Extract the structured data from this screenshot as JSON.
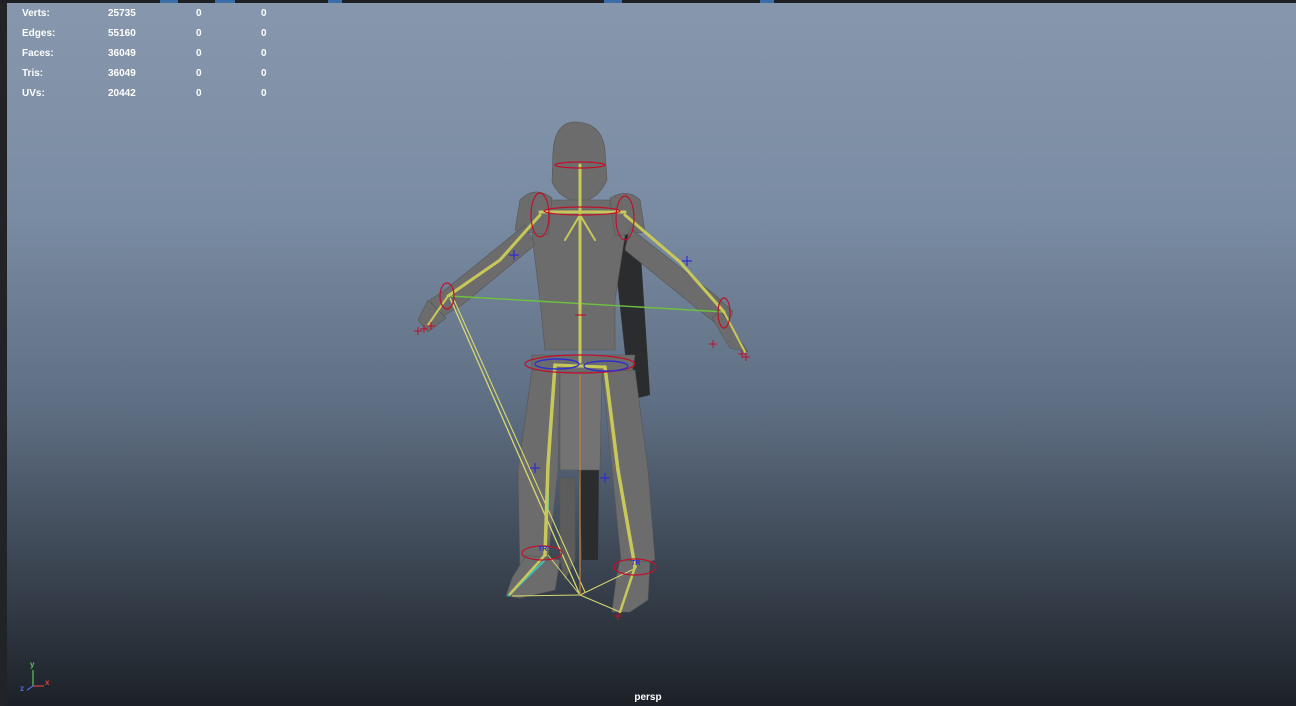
{
  "hud": {
    "rows": [
      {
        "label": "Verts:",
        "total": "25735",
        "selected": "0",
        "third": "0"
      },
      {
        "label": "Edges:",
        "total": "55160",
        "selected": "0",
        "third": "0"
      },
      {
        "label": "Faces:",
        "total": "36049",
        "selected": "0",
        "third": "0"
      },
      {
        "label": "Tris:",
        "total": "36049",
        "selected": "0",
        "third": "0"
      },
      {
        "label": "UVs:",
        "total": "20442",
        "selected": "0",
        "third": "0"
      }
    ]
  },
  "viewport": {
    "camera": "persp",
    "axis": {
      "y": "y",
      "x": "x",
      "z": "z"
    }
  },
  "colors": {
    "joint": "#c8c85a",
    "control_red": "#c0102c",
    "control_blue": "#2e2ecc",
    "ik_line": "#d8d870",
    "pole_line": "#6ec040",
    "mesh": "#6c6c6c"
  }
}
